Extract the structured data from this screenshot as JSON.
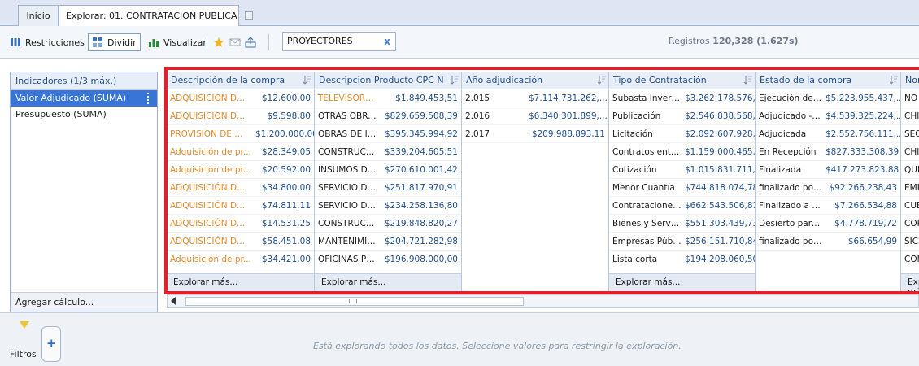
{
  "tabs": [
    {
      "label": "Inicio"
    },
    {
      "label": "Explorar: 01. CONTRATACION PUBLICA"
    }
  ],
  "toolbar": {
    "restricciones": "Restricciones",
    "dividir": "Dividir",
    "visualizar": "Visualizar",
    "search_value": "PROYECTORES",
    "clear": "x",
    "registros_label": "Registros",
    "registros_value": "120,328 (1.627s)"
  },
  "indicators": {
    "header": "Indicadores (1/3 máx.)",
    "items": [
      "Valor Adjudicado (SUMA)",
      "Presupuesto (SUMA)"
    ],
    "add_label": "Agregar cálculo..."
  },
  "grid": {
    "explore_more": "Explorar más...",
    "columns": [
      {
        "header": "Descripción de la compra",
        "rows": [
          [
            "ADQUISICION D...",
            "$12.600,00"
          ],
          [
            "ADQUISICION D...",
            "$9.598,80"
          ],
          [
            "PROVISIÓN DE ...",
            "$1.200.000,00"
          ],
          [
            "Adquisición de pr...",
            "$28.349,05"
          ],
          [
            "Adquisicion de pr...",
            "$20.592,00"
          ],
          [
            "ADQUISICIÓN D...",
            "$34.800,00"
          ],
          [
            "ADQUISICIÓN D...",
            "$74.811,11"
          ],
          [
            "ADQUISICIÓN D...",
            "$14.531,25"
          ],
          [
            "ADQUISICIÓN D...",
            "$58.451,08"
          ],
          [
            "Adquisición de pr...",
            "$34.421,00"
          ]
        ]
      },
      {
        "header": "Descripcion Producto CPC N",
        "rows": [
          [
            "TELEVISORES, ...",
            "$1.849.453,51"
          ],
          [
            "OTRAS OBRAS D...",
            "$829.659.508,39"
          ],
          [
            "OBRAS DE INGE...",
            "$395.345.994,92"
          ],
          [
            "CONSTRUCCIO...",
            "$339.204.605,51"
          ],
          [
            "INSUMOS DE US...",
            "$270.610.001,42"
          ],
          [
            "SERVICIO DE C...",
            "$251.817.970,91"
          ],
          [
            "SERVICIO DE C...",
            "$234.258.136,80"
          ],
          [
            "CONSTRUCCIO...",
            "$219.848.820,27"
          ],
          [
            "MANTENIMIENT...",
            "$204.721.282,98"
          ],
          [
            "OFICINAS PREF...",
            "$196.908.000,00"
          ]
        ]
      },
      {
        "header": "Año adjudicación",
        "rows": [
          [
            "2.015",
            "$7.114.731.262,..."
          ],
          [
            "2.016",
            "$6.340.301.899,..."
          ],
          [
            "2.017",
            "$209.988.893,11"
          ]
        ]
      },
      {
        "header": "Tipo de Contratación",
        "rows": [
          [
            "Subasta Inversa ...",
            "$3.262.178.576,..."
          ],
          [
            "Publicación",
            "$2.546.838.568,..."
          ],
          [
            "Licitación",
            "$2.092.607.928,..."
          ],
          [
            "Contratos entre E...",
            "$1.159.000.465,..."
          ],
          [
            "Cotización",
            "$1.015.831.711,..."
          ],
          [
            "Menor Cuantía",
            "$744.818.074,78"
          ],
          [
            "Contrataciones c...",
            "$662.543.506,81"
          ],
          [
            "Bienes y Servicio...",
            "$551.303.439,73"
          ],
          [
            "Empresas Pública...",
            "$256.151.710,84"
          ],
          [
            "Lista corta",
            "$194.208.060,50"
          ]
        ]
      },
      {
        "header": "Estado de la compra",
        "rows": [
          [
            "Ejecución de Cont...",
            "$5.223.955.437,..."
          ],
          [
            "Adjudicado - Regi...",
            "$4.539.325.224,..."
          ],
          [
            "Adjudicada",
            "$2.552.756.111,..."
          ],
          [
            "En Recepción",
            "$827.333.308,39"
          ],
          [
            "Finalizada",
            "$417.273.823,88"
          ],
          [
            "finalizado por mut...",
            "$92.266.238,43"
          ],
          [
            "Finalizado a solici...",
            "$7.266.534,88"
          ],
          [
            "Desierto parcial",
            "$4.778.719,72"
          ],
          [
            "finalizado por diso...",
            "$66.654,99"
          ]
        ]
      },
      {
        "header": "Nom",
        "rows": [
          [
            "NO D"
          ],
          [
            "CHI"
          ],
          [
            "SEGU"
          ],
          [
            "CHI"
          ],
          [
            "QUI"
          ],
          [
            "EMP"
          ],
          [
            "CUE"
          ],
          [
            "COR"
          ],
          [
            "SICP"
          ],
          [
            "COM"
          ]
        ]
      }
    ]
  },
  "filters": {
    "label": "Filtros",
    "add": "+",
    "message": "Está explorando todos los datos. Seleccione valores para restringir la exploración."
  }
}
